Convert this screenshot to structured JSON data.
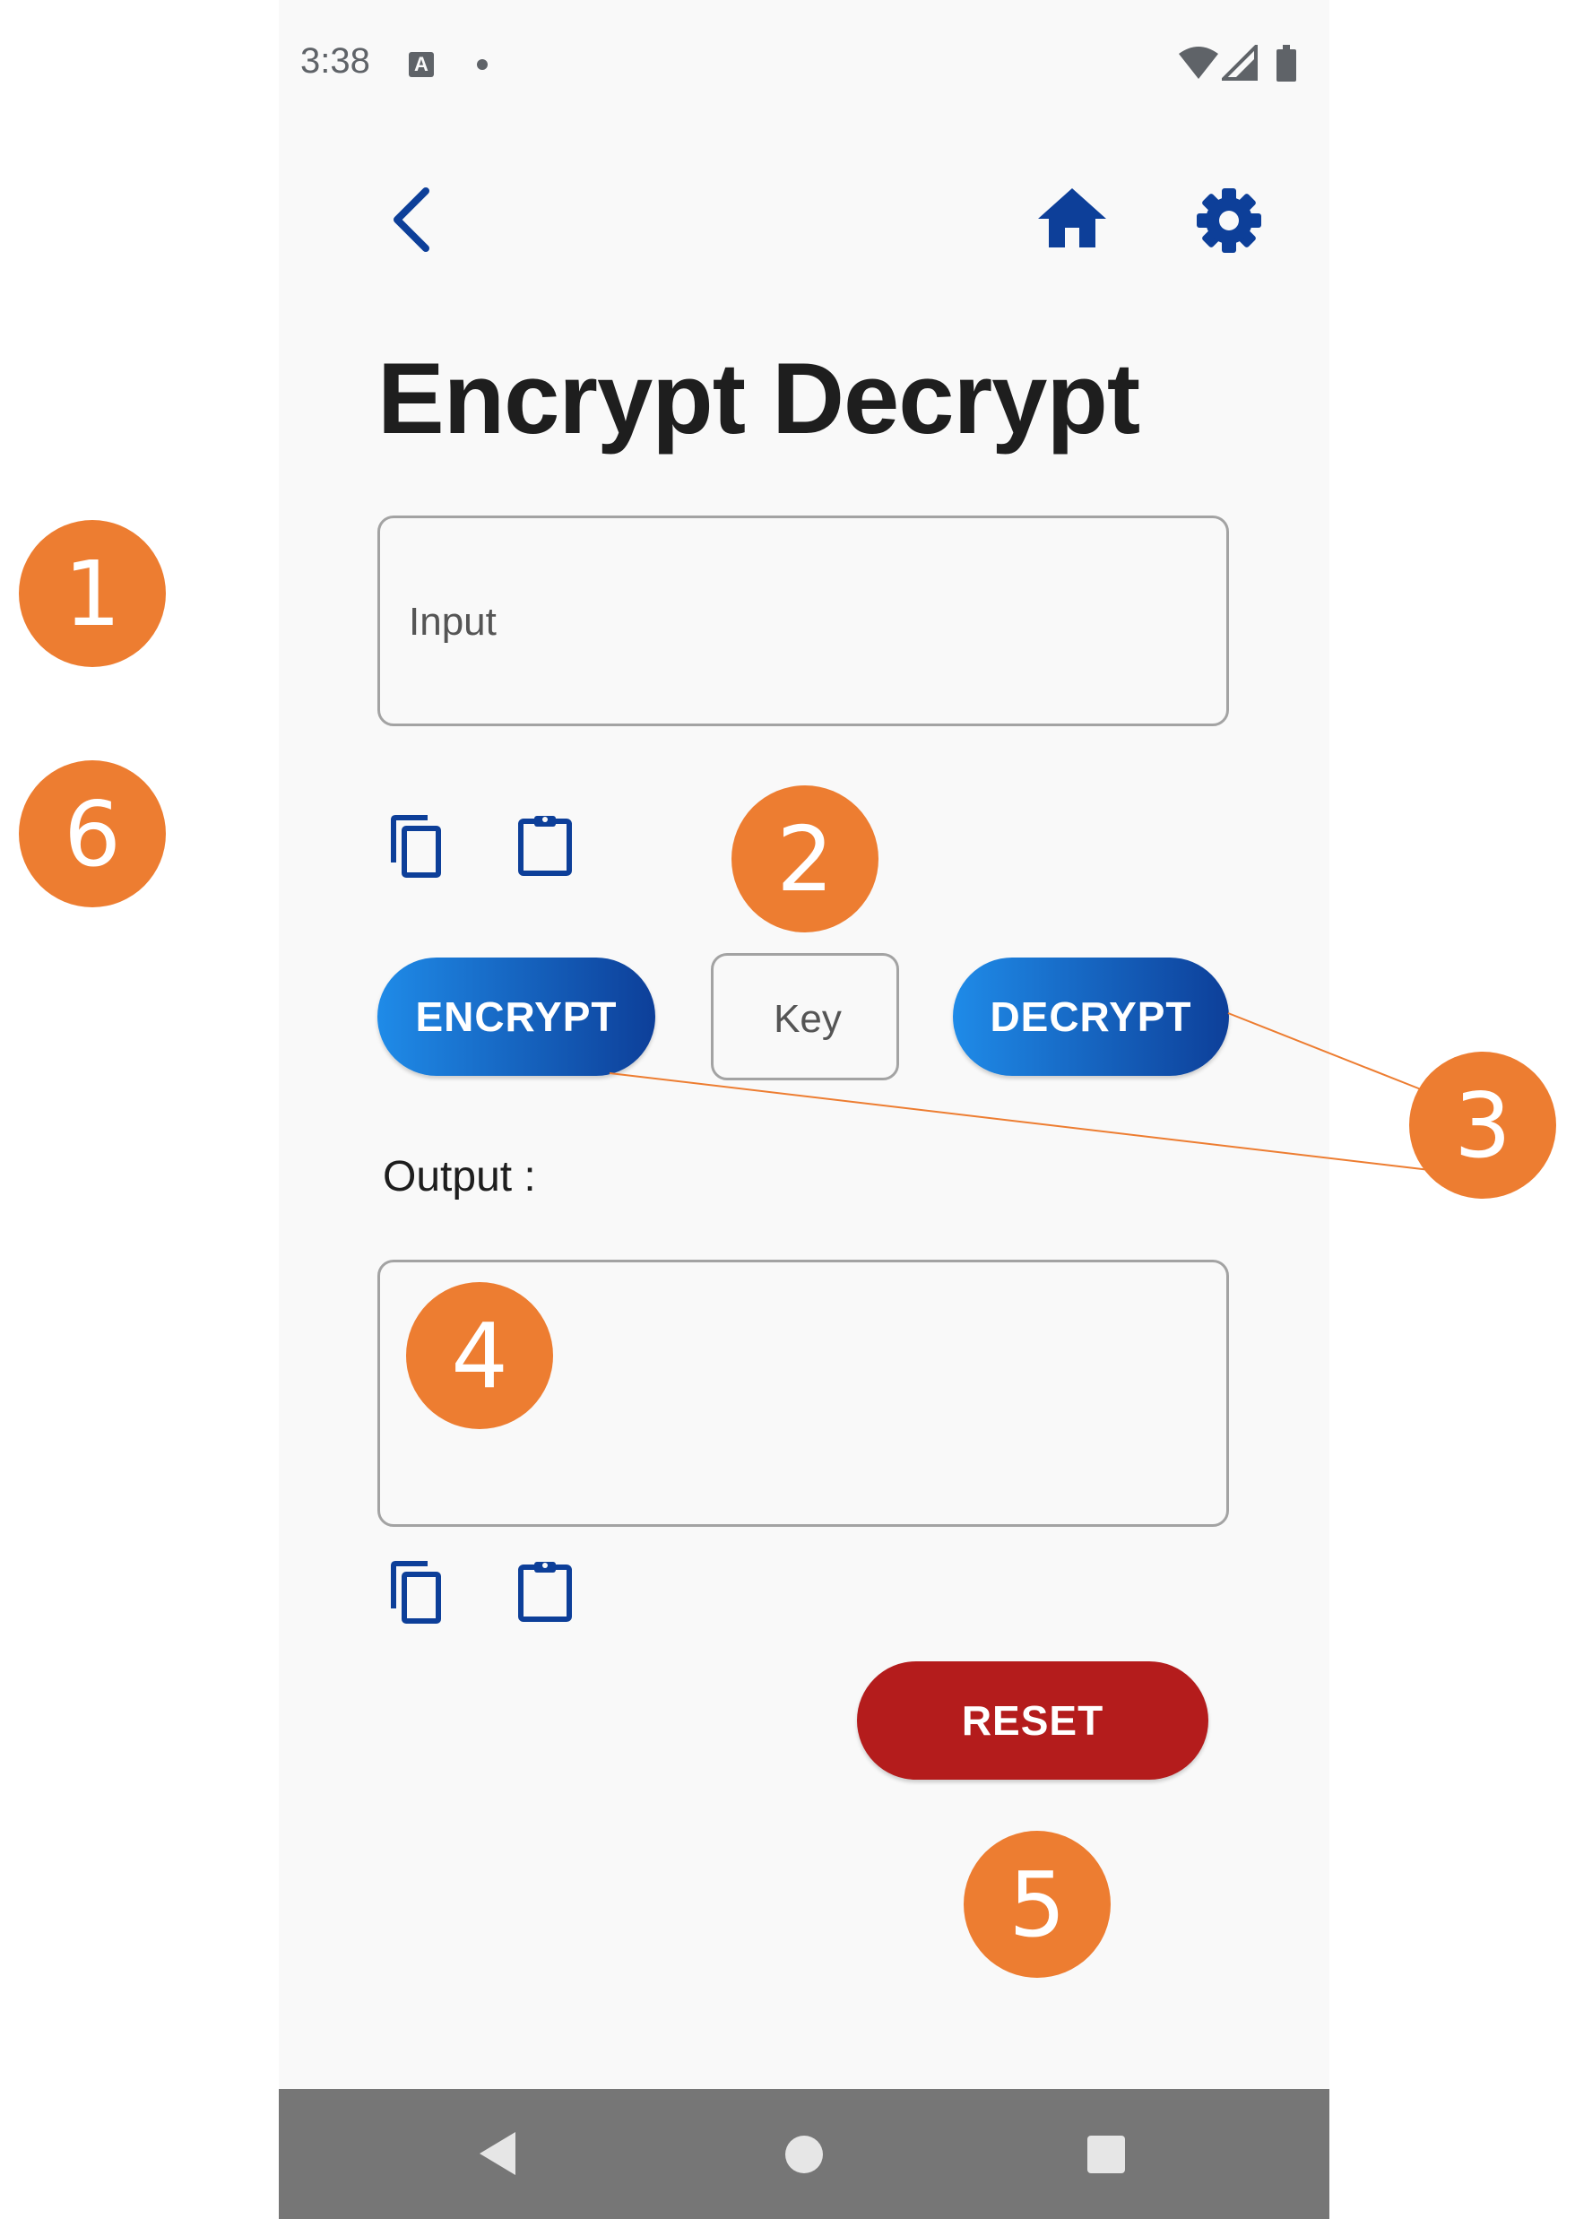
{
  "status_bar": {
    "time": "3:38",
    "notification_icon": "A"
  },
  "top_nav": {
    "back_icon": "chevron-left",
    "home_icon": "home",
    "settings_icon": "gear"
  },
  "page": {
    "title": "Encrypt Decrypt"
  },
  "input_section": {
    "placeholder": "Input",
    "value": "",
    "copy_icon": "copy",
    "paste_icon": "clipboard"
  },
  "actions": {
    "encrypt_label": "ENCRYPT",
    "key_placeholder": "Key",
    "decrypt_label": "DECRYPT"
  },
  "output_section": {
    "label": "Output :",
    "value": "",
    "copy_icon": "copy",
    "paste_icon": "clipboard"
  },
  "reset": {
    "label": "RESET"
  },
  "system_nav": {
    "back_icon": "triangle-back",
    "home_icon": "circle-home",
    "recents_icon": "square-recents"
  },
  "annotations": [
    "1",
    "2",
    "3",
    "4",
    "5",
    "6"
  ],
  "colors": {
    "primary": "#0d3f99",
    "gradient_start": "#1f8be8",
    "reset": "#b41c1c",
    "annotation": "#ed7d31",
    "background": "#f9f9f9"
  }
}
